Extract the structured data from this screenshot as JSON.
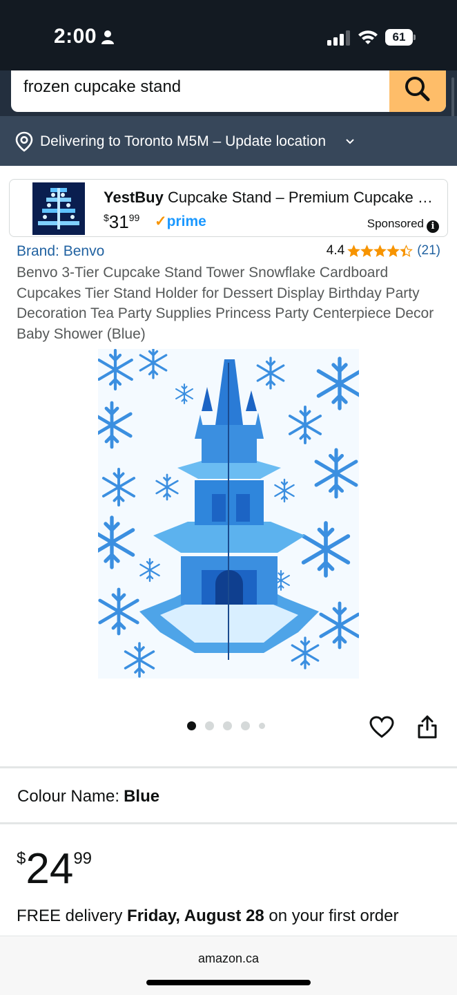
{
  "status_bar": {
    "time": "2:00",
    "battery": "61",
    "icons": [
      "person-icon",
      "signal-icon",
      "wifi-icon",
      "battery-icon"
    ]
  },
  "search": {
    "query": "frozen cupcake stand",
    "button_icon": "search-icon"
  },
  "location": {
    "text": "Delivering to Toronto M5M – Update location"
  },
  "sponsored_ad": {
    "brand": "YestBuy",
    "title": " Cupcake Stand – Premium Cupcake Stand",
    "price_symbol": "$",
    "price_whole": "31",
    "price_fraction": "99",
    "prime_check": "✓",
    "prime_label": "prime",
    "sponsored_label": "Sponsored",
    "info_glyph": "i"
  },
  "product": {
    "brand_link": "Brand: Benvo",
    "rating": "4.4",
    "rating_fraction": 0.88,
    "rating_count": "(21)",
    "title": "Benvo 3-Tier Cupcake Stand Tower Snowflake Cardboard Cupcakes Tier Stand Holder for Dessert Display Birthday Party Decoration Tea Party Supplies Princess Party Centerpiece Decor Baby Shower (Blue)",
    "image_count": 5,
    "active_image": 1
  },
  "colour": {
    "label": "Colour Name:",
    "value": "Blue"
  },
  "price": {
    "symbol": "$",
    "whole": "24",
    "fraction": "99"
  },
  "delivery": {
    "prefix": "FREE delivery ",
    "date": "Friday, August 28",
    "suffix": " on your first order"
  },
  "footer": {
    "domain": "amazon.ca"
  },
  "colors": {
    "header_dark": "#131a22",
    "header": "#232f3e",
    "location_bar": "#37475a",
    "search_button": "#febd69",
    "link": "#2162a1",
    "star": "#f79400",
    "prime": "#1a98ff"
  }
}
